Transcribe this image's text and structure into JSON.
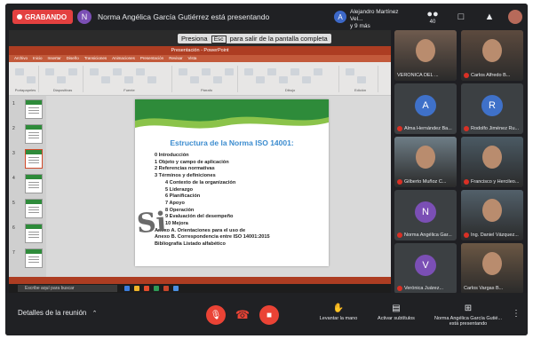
{
  "top_bar": {
    "recording_label": "GRABANDO",
    "presenter_initial": "N",
    "presenting_text": "Norma Angélica García Gutiérrez está presentando",
    "participant2_initial": "A",
    "participant2_line1": "Alejandro Martínez Vel...",
    "participant2_line2": "y 9 más",
    "people_count": "40",
    "chat_icon": "chat-icon",
    "activities_icon": "activities-icon"
  },
  "screen": {
    "esc_banner_pre": "Presiona",
    "esc_key": "Esc",
    "esc_banner_post": "para salir de la pantalla completa",
    "ppt_title": "Presentación - PowerPoint",
    "ribbon_tabs": [
      "Archivo",
      "Inicio",
      "Insertar",
      "Diseño",
      "Transiciones",
      "Animaciones",
      "Presentación",
      "Revisar",
      "Vista"
    ],
    "ribbon_groups": [
      "Portapapeles",
      "Diapositivas",
      "Fuente",
      "Párrafo",
      "Dibujo",
      "Edición"
    ],
    "thumb_numbers": [
      "1",
      "2",
      "3",
      "4",
      "5",
      "6",
      "7"
    ],
    "taskbar_search": "Escribe aquí para buscar"
  },
  "slide": {
    "title": "Estructura de la Norma ISO 14001:",
    "items": [
      {
        "text": "0 Introducción",
        "level": "top"
      },
      {
        "text": "1 Objeto y campo de aplicación",
        "level": "top"
      },
      {
        "text": "2 Referencias normativas",
        "level": "top"
      },
      {
        "text": "3 Términos y definiciones",
        "level": "top"
      },
      {
        "text": "4 Contexto de la organización",
        "level": "sub"
      },
      {
        "text": "5 Liderazgo",
        "level": "sub"
      },
      {
        "text": "6 Planificación",
        "level": "sub"
      },
      {
        "text": "7 Apoyo",
        "level": "sub"
      },
      {
        "text": "8 Operación",
        "level": "sub"
      },
      {
        "text": "9 Evaluación del desempeño",
        "level": "sub"
      },
      {
        "text": "10 Mejora",
        "level": "sub"
      },
      {
        "text": "Anexo A. Orientaciones para el uso de",
        "level": "top"
      },
      {
        "text": "Anexo B. Correspondencia entre ISO 14001:2015",
        "level": "top"
      },
      {
        "text": "Bibliografía Listado alfabético",
        "level": "top"
      }
    ],
    "logo_text": "Si"
  },
  "participants": [
    {
      "name": "VERÓNICA DEL ...",
      "initial": "",
      "color": "#6f5b4e",
      "photo": true,
      "muted": false
    },
    {
      "name": "Carlos Alfredo B...",
      "initial": "",
      "color": "#5c4a3e",
      "photo": true,
      "muted": true
    },
    {
      "name": "Alma Hernández Ba...",
      "initial": "A",
      "color": "#3f71c9",
      "photo": false,
      "muted": true
    },
    {
      "name": "Rodolfo Jiménez Ru...",
      "initial": "R",
      "color": "#3f71c9",
      "photo": false,
      "muted": true
    },
    {
      "name": "Gilberto Muñoz C...",
      "initial": "",
      "color": "#6e7d86",
      "photo": true,
      "muted": true
    },
    {
      "name": "Francisco y Hercileo...",
      "initial": "",
      "color": "#4b5a64",
      "photo": true,
      "muted": true
    },
    {
      "name": "Norma Angélica Gar...",
      "initial": "N",
      "color": "#7b4fb5",
      "photo": false,
      "muted": true
    },
    {
      "name": "Ing. Daniel Vázquez...",
      "initial": "",
      "color": "#52606a",
      "photo": true,
      "muted": true
    },
    {
      "name": "Verónica Juárez...",
      "initial": "V",
      "color": "#7b4fb5",
      "photo": false,
      "muted": true
    },
    {
      "name": "Carlos Vargas B...",
      "initial": "",
      "color": "#6b5744",
      "photo": true,
      "muted": false
    }
  ],
  "controls": {
    "details_label": "Detalles de la reunión",
    "raise_hand_label": "Levantar la mano",
    "captions_label": "Activar subtítulos",
    "presenting_line1": "Norma Angélica García Gutié...",
    "presenting_line2": "está presentando"
  }
}
